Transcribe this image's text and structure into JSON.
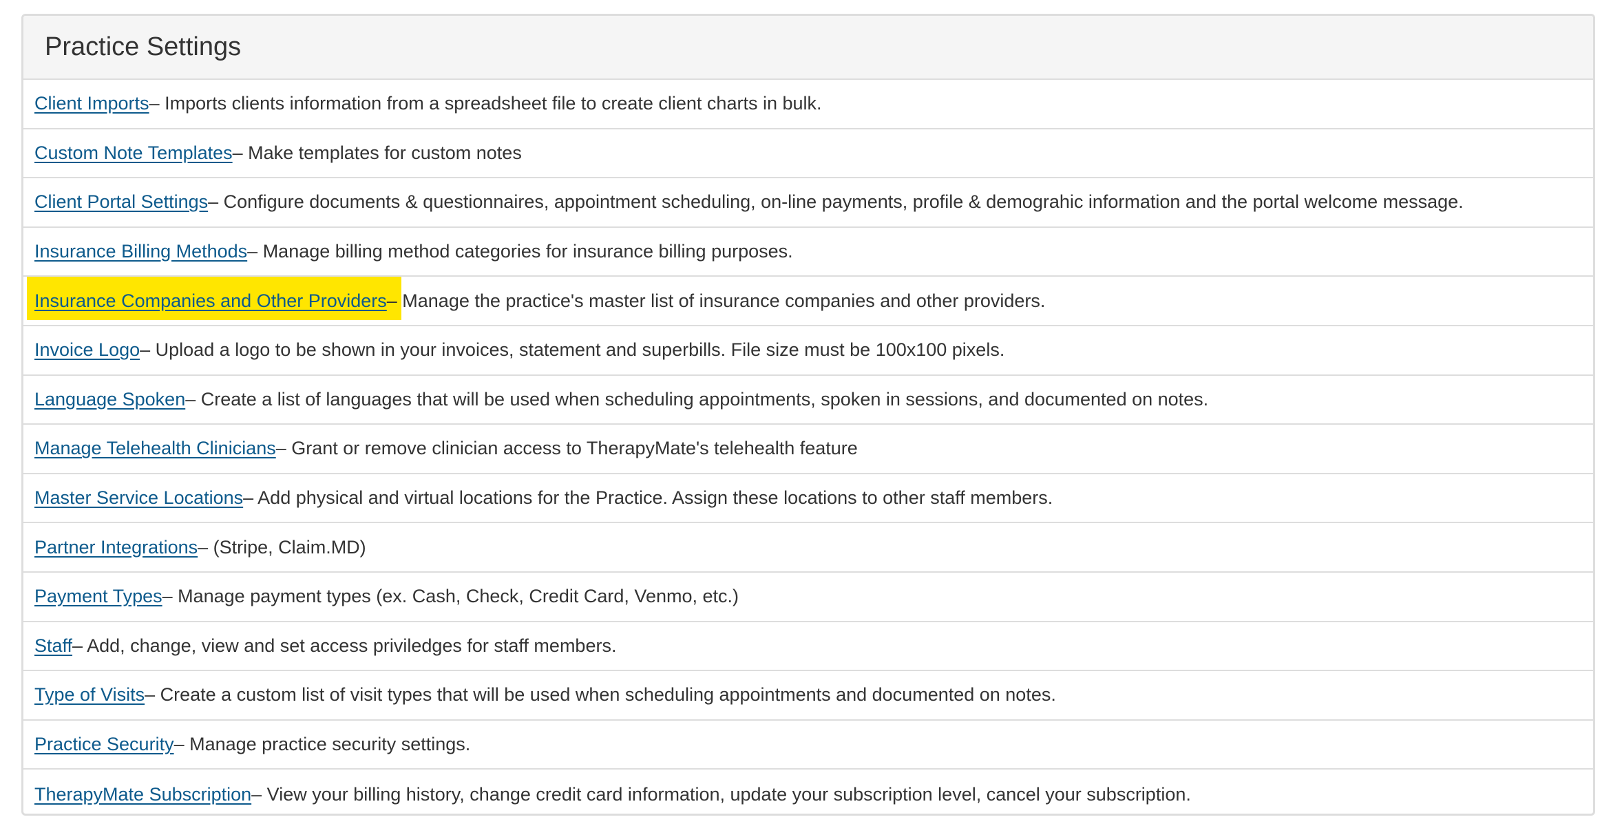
{
  "panel": {
    "title": "Practice Settings"
  },
  "highlight_color": "#ffe600",
  "link_color": "#0d5a8c",
  "items": [
    {
      "label": "Client Imports",
      "desc": " – Imports clients information from a spreadsheet file to create client charts in bulk."
    },
    {
      "label": "Custom Note Templates",
      "desc": " – Make templates for custom notes"
    },
    {
      "label": "Client Portal Settings",
      "desc": " – Configure documents & questionnaires, appointment scheduling, on-line payments, profile & demograhic information and the portal welcome message."
    },
    {
      "label": "Insurance Billing Methods",
      "desc": " – Manage billing method categories for insurance billing purposes."
    },
    {
      "label": "Insurance Companies and Other Providers",
      "desc": " – Manage the practice's master list of insurance companies and other providers.",
      "highlighted": true
    },
    {
      "label": "Invoice Logo",
      "desc": " – Upload a logo to be shown in your invoices, statement and superbills. File size must be 100x100 pixels."
    },
    {
      "label": "Language Spoken",
      "desc": " – Create a list of languages that will be used when scheduling appointments, spoken in sessions, and documented on notes."
    },
    {
      "label": "Manage Telehealth Clinicians",
      "desc": " – Grant or remove clinician access to TherapyMate's telehealth feature"
    },
    {
      "label": "Master Service Locations",
      "desc": " – Add physical and virtual locations for the Practice. Assign these locations to other staff members."
    },
    {
      "label": "Partner Integrations",
      "desc": " – (Stripe, Claim.MD)"
    },
    {
      "label": "Payment Types",
      "desc": " – Manage payment types (ex. Cash, Check, Credit Card, Venmo, etc.)"
    },
    {
      "label": "Staff",
      "desc": " – Add, change, view and set access priviledges for staff members."
    },
    {
      "label": "Type of Visits",
      "desc": " – Create a custom list of visit types that will be used when scheduling appointments and documented on notes."
    },
    {
      "label": "Practice Security",
      "desc": " – Manage practice security settings."
    },
    {
      "label": "TherapyMate Subscription",
      "desc": " – View your billing history, change credit card information, update your subscription level, cancel your subscription."
    }
  ]
}
